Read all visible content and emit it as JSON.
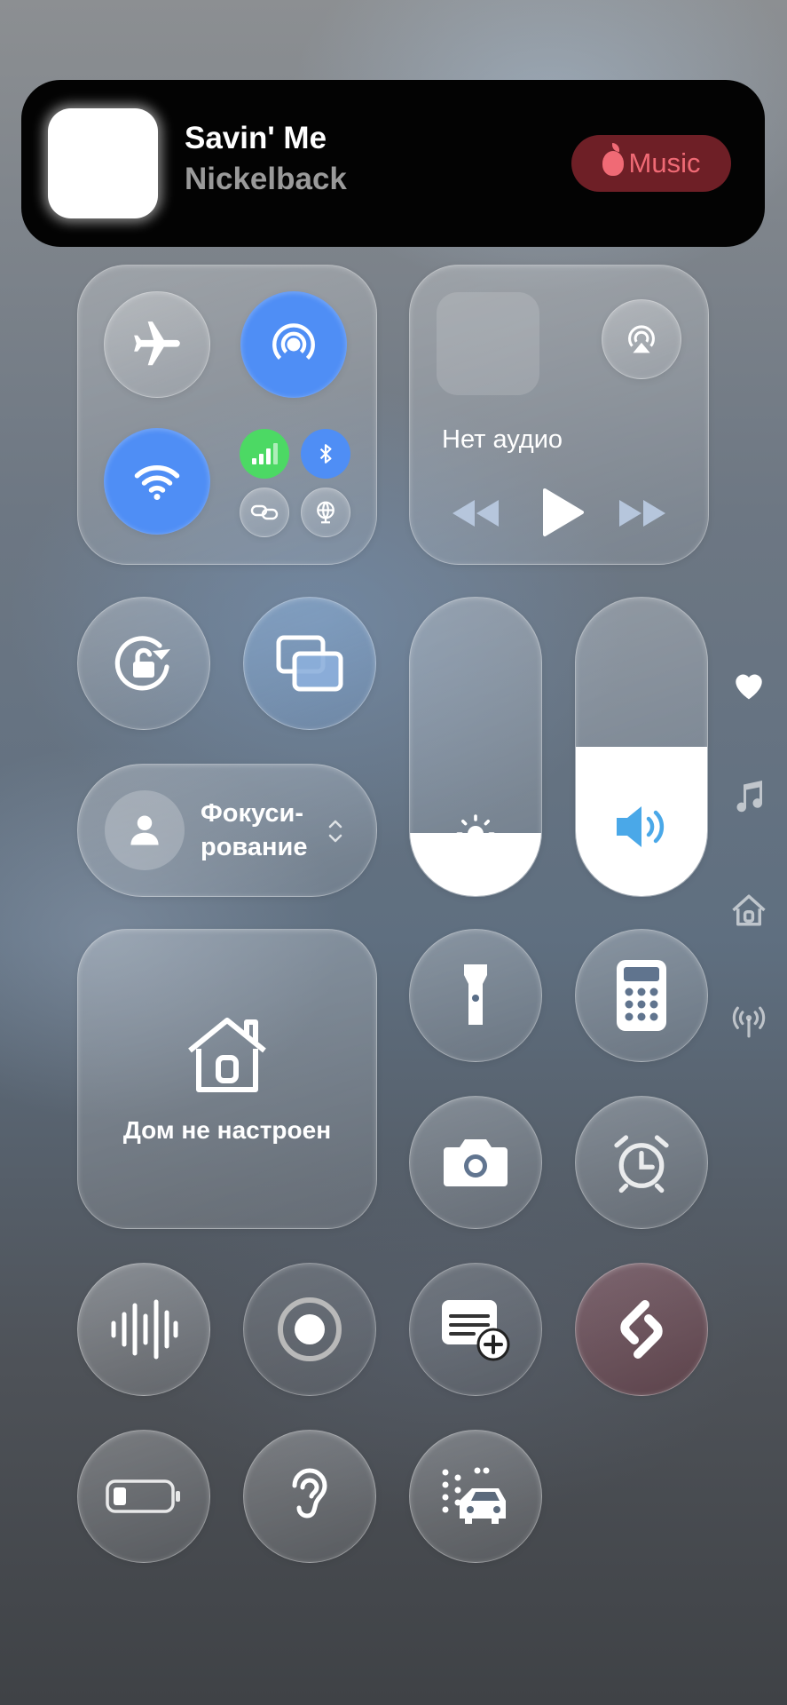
{
  "now_playing": {
    "title": "Savin' Me",
    "artist": "Nickelback",
    "app_badge": "Music",
    "app_icon": "apple-logo-icon"
  },
  "connectivity": {
    "airplane": {
      "icon": "airplane-icon",
      "active": false
    },
    "airdrop": {
      "icon": "airdrop-icon",
      "active": true
    },
    "wifi": {
      "icon": "wifi-icon",
      "active": true
    },
    "cellular": {
      "icon": "cellular-signal-icon",
      "active": true,
      "color": "#4cd964"
    },
    "bluetooth": {
      "icon": "bluetooth-icon",
      "active": true
    },
    "hotspot": {
      "icon": "personal-hotspot-icon",
      "active": false
    },
    "vpn": {
      "icon": "vpn-globe-icon",
      "active": false
    }
  },
  "media": {
    "status": "Нет аудио",
    "airplay_icon": "airplay-icon",
    "controls": [
      "rewind-icon",
      "play-icon",
      "fast-forward-icon"
    ]
  },
  "focus": {
    "label": "Фокуси-\nрование",
    "icon": "person-icon"
  },
  "home": {
    "label": "Дом не настроен",
    "icon": "home-icon"
  },
  "brightness": {
    "level": 0.21,
    "icon": "sun-icon"
  },
  "volume": {
    "level": 0.5,
    "icon": "speaker-icon"
  },
  "toggles": [
    "rotation-lock-icon",
    "screen-mirroring-icon",
    "flashlight-icon",
    "calculator-icon",
    "camera-icon",
    "alarm-icon",
    "voice-memo-icon",
    "screen-record-icon",
    "quick-note-icon",
    "shazam-icon",
    "low-power-mode-icon",
    "hearing-icon",
    "vehicle-motion-cues-icon"
  ],
  "side_pages": [
    "heart-icon",
    "music-note-icon",
    "home-icon",
    "antenna-icon"
  ],
  "colors": {
    "accent_blue": "#4f8ef5",
    "music_badge": "#6e1f26",
    "music_text": "#f06a75",
    "volume_icon": "#4aa8e8"
  }
}
